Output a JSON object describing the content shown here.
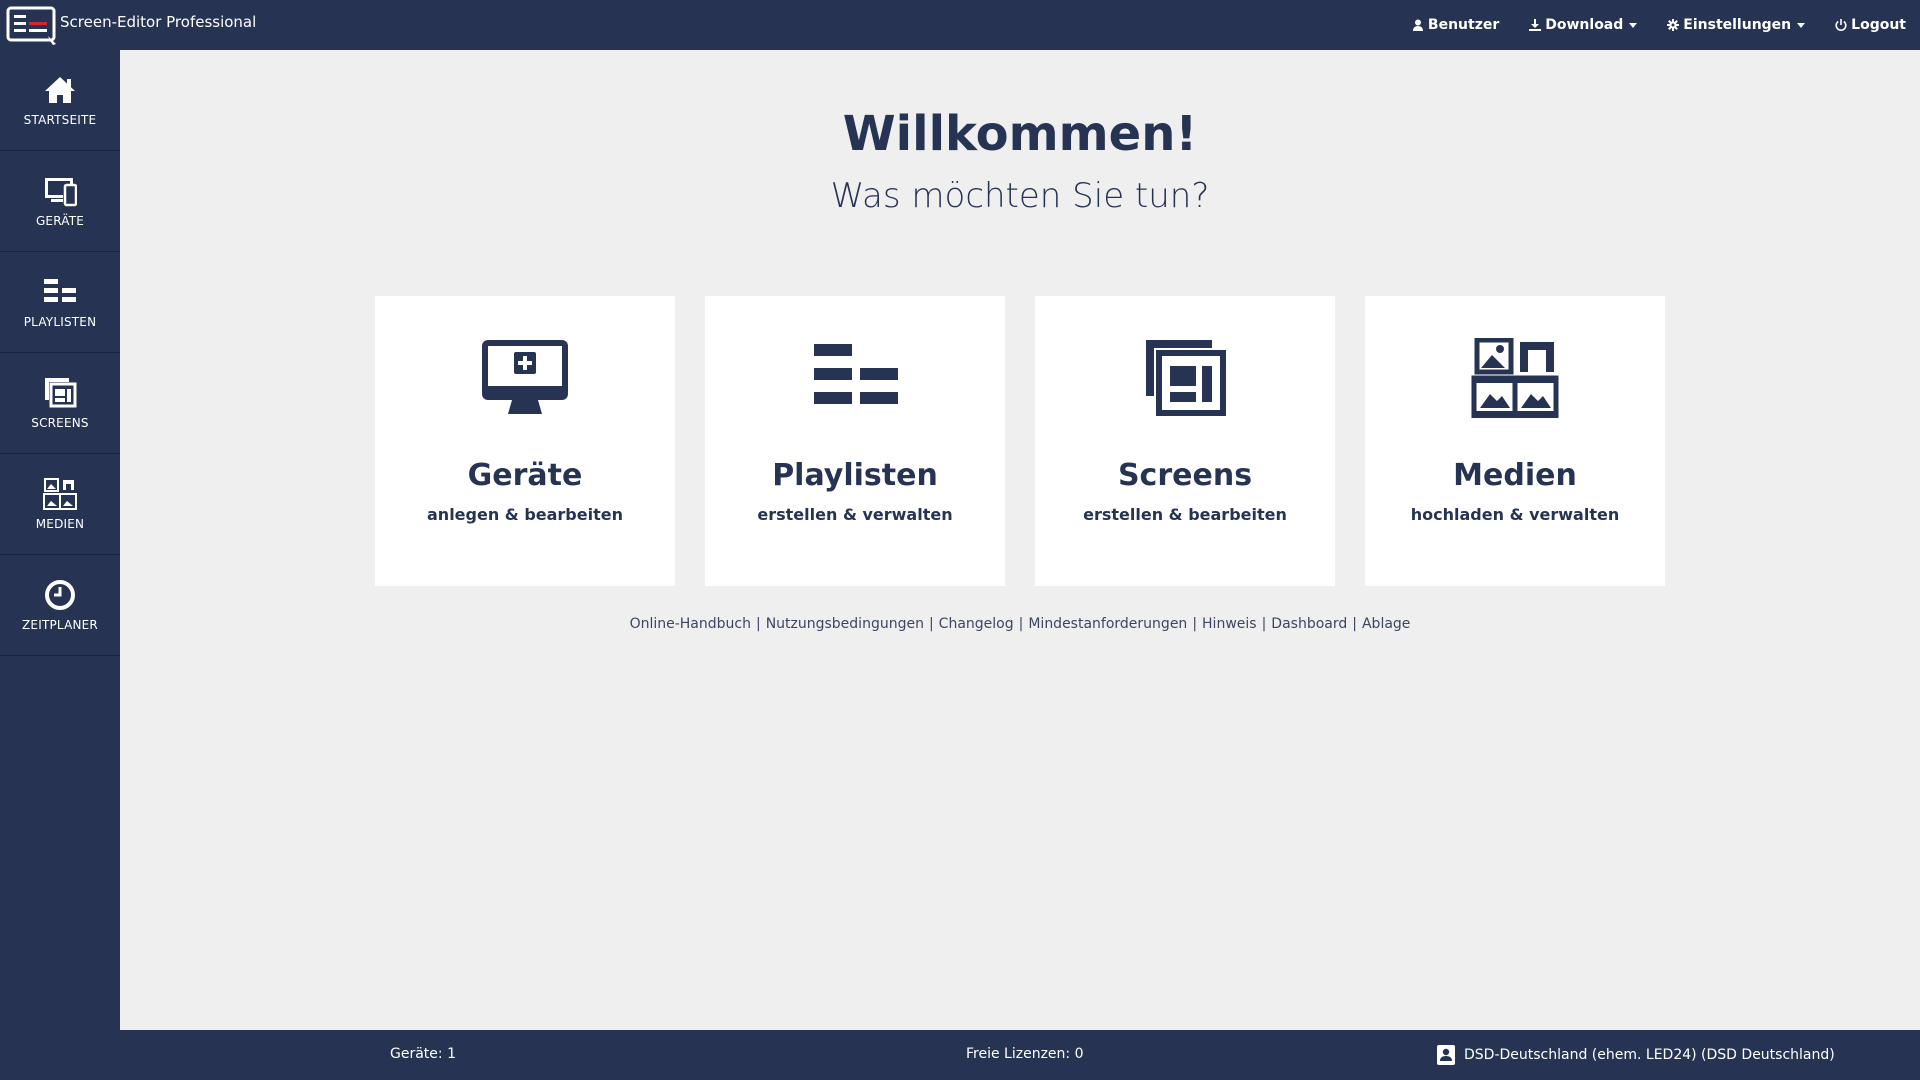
{
  "app": {
    "title": "Screen-Editor Professional"
  },
  "topnav": {
    "user": "Benutzer",
    "download": "Download",
    "settings": "Einstellungen",
    "logout": "Logout"
  },
  "sidebar": {
    "items": [
      {
        "label": "STARTSEITE",
        "icon": "home-icon"
      },
      {
        "label": "GERÄTE",
        "icon": "devices-icon"
      },
      {
        "label": "PLAYLISTEN",
        "icon": "playlist-icon"
      },
      {
        "label": "SCREENS",
        "icon": "screens-icon"
      },
      {
        "label": "MEDIEN",
        "icon": "media-icon"
      },
      {
        "label": "ZEITPLANER",
        "icon": "clock-icon"
      }
    ]
  },
  "main": {
    "welcome": "Willkommen!",
    "subtitle": "Was möchten Sie tun?",
    "cards": [
      {
        "title": "Geräte",
        "subtitle": "anlegen & bearbeiten",
        "icon": "monitor-add-icon"
      },
      {
        "title": "Playlisten",
        "subtitle": "erstellen & verwalten",
        "icon": "playlist-icon"
      },
      {
        "title": "Screens",
        "subtitle": "erstellen & bearbeiten",
        "icon": "screens-icon"
      },
      {
        "title": "Medien",
        "subtitle": "hochladen & verwalten",
        "icon": "media-icon"
      }
    ],
    "links": [
      "Online-Handbuch",
      "Nutzungsbedingungen",
      "Changelog",
      "Mindestanforderungen",
      "Hinweis",
      "Dashboard",
      "Ablage"
    ],
    "separator": "|"
  },
  "footer": {
    "devices": "Geräte: 1",
    "licenses": "Freie Lizenzen: 0",
    "company": "DSD-Deutschland (ehem. LED24) (DSD Deutschland)"
  },
  "colors": {
    "navy": "#263352",
    "background": "#efefef",
    "card": "#ffffff",
    "logo_red": "#d9262e"
  }
}
